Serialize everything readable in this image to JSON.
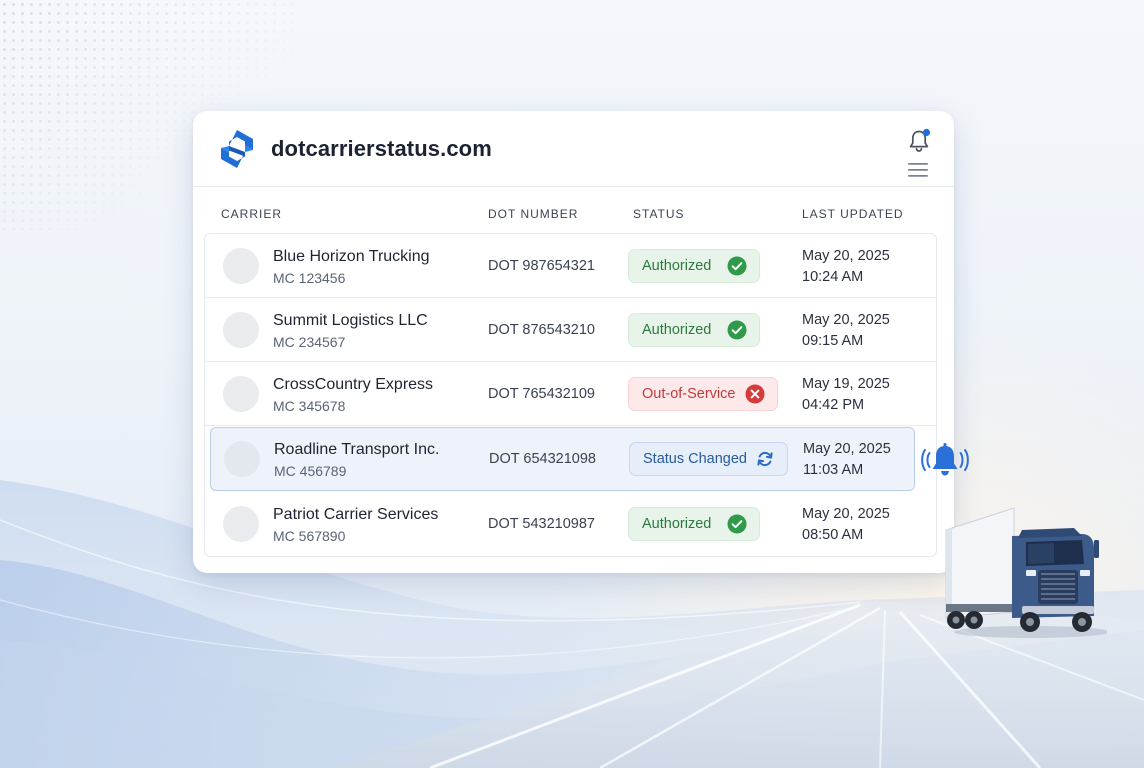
{
  "app": {
    "brand": "dotcarrierstatus.com"
  },
  "table": {
    "columns": {
      "carrier": "CARRIER",
      "dot_number": "DOT NUMBER",
      "status": "STATUS",
      "last_updated": "LAST UPDATED"
    },
    "rows": [
      {
        "name": "Blue Horizon Trucking",
        "mc": "MC 123456",
        "dot": "DOT 987654321",
        "status": "Authorized",
        "status_type": "authorized",
        "date": "May 20, 2025",
        "time": "10:24 AM"
      },
      {
        "name": "Summit Logistics LLC",
        "mc": "MC 234567",
        "dot": "DOT 876543210",
        "status": "Authorized",
        "status_type": "authorized",
        "date": "May 20, 2025",
        "time": "09:15 AM"
      },
      {
        "name": "CrossCountry Express",
        "mc": "MC 345678",
        "dot": "DOT 765432109",
        "status": "Out-of-Service",
        "status_type": "out-of-service",
        "date": "May 19, 2025",
        "time": "04:42 PM"
      },
      {
        "name": "Roadline Transport Inc.",
        "mc": "MC 456789",
        "dot": "DOT 654321098",
        "status": "Status Changed",
        "status_type": "changed",
        "date": "May 20, 2025",
        "time": "11:03 AM"
      },
      {
        "name": "Patriot Carrier Services",
        "mc": "MC 567890",
        "dot": "DOT 543210987",
        "status": "Authorized",
        "status_type": "authorized",
        "date": "May 20, 2025",
        "time": "08:50 AM"
      }
    ]
  },
  "colors": {
    "brand_blue": "#1f6fd6",
    "authorized_green": "#2b7a3d",
    "out_of_service_red": "#d43a3a",
    "changed_blue": "#2a5a9c"
  },
  "icons": {
    "logo": "brand-logo-icon",
    "notification": "bell-icon",
    "menu": "hamburger-menu-icon",
    "authorized": "check-circle-icon",
    "out_of_service": "x-circle-icon",
    "changed": "refresh-icon",
    "alert": "ringing-bell-icon"
  }
}
